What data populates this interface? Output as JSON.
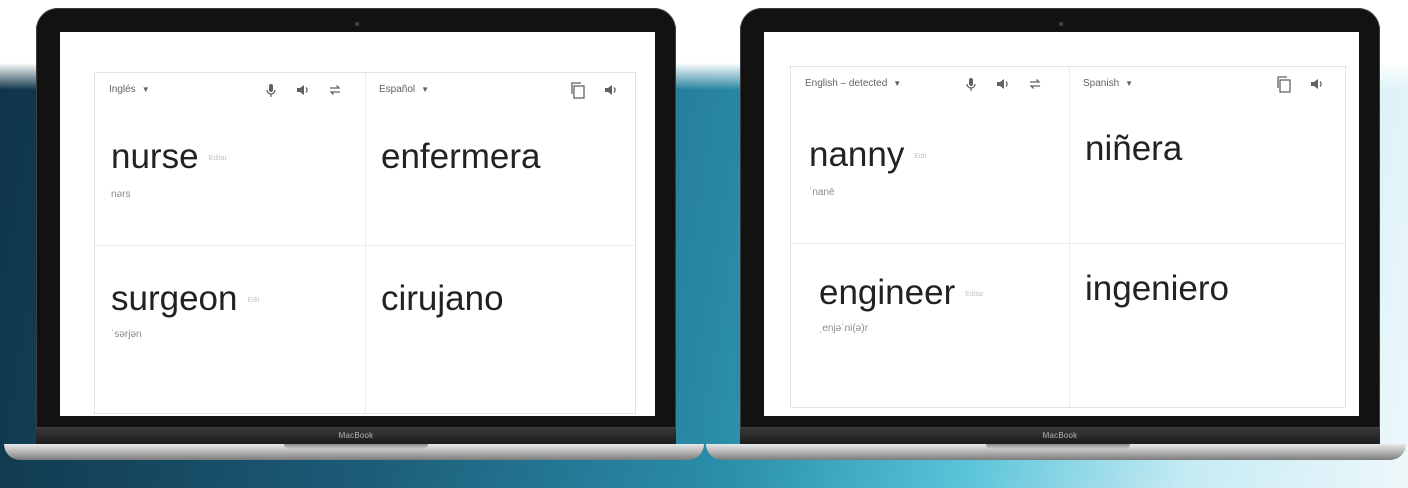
{
  "left_screen": {
    "source_lang": "Inglés",
    "target_lang": "Español",
    "rows": [
      {
        "word": "nurse",
        "edit": "Editar",
        "phonetic": "nərs",
        "translation": "enfermera"
      },
      {
        "word": "surgeon",
        "edit": "Edit",
        "phonetic": "ˈsərjən",
        "translation": "cirujano"
      }
    ]
  },
  "right_screen": {
    "source_lang": "English – detected",
    "target_lang": "Spanish",
    "rows": [
      {
        "word": "nanny",
        "edit": "Edit",
        "phonetic": "ˈnanē",
        "translation": "niñera"
      },
      {
        "word": "engineer",
        "edit": "Editar",
        "phonetic": "ˌenjəˈni(ə)r",
        "translation": "ingeniero"
      }
    ]
  },
  "laptop_brand": "MacBook",
  "icons": [
    "mic-icon",
    "speaker-icon",
    "swap-icon",
    "copy-icon"
  ]
}
